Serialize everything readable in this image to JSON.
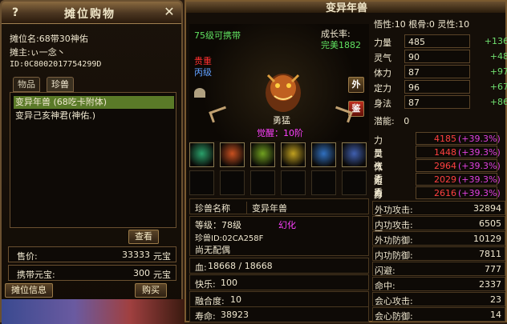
{
  "stall": {
    "title": "摊位购物",
    "help_label": "?",
    "close_label": "✕",
    "stall_name_line": "摊位名:68带30神佑",
    "owner_line": "摊主:ぃ一念丶",
    "id_line": "ID:0C8002017754299D",
    "tabs": [
      {
        "label": "物品",
        "active": false
      },
      {
        "label": "珍兽",
        "active": true
      }
    ],
    "items": [
      {
        "label": "变异年兽 (68吃卡附体)",
        "selected": true
      },
      {
        "label": "变异己亥神君(神佑.)",
        "selected": false
      }
    ],
    "view_button": "查看",
    "price_label": "售价:",
    "price_value": "33333",
    "price_unit": "元宝",
    "carry_label": "携带元宝:",
    "carry_value": "300",
    "carry_unit": "元宝",
    "info_button": "摊位信息",
    "buy_button": "购买"
  },
  "pet": {
    "title": "变异年兽",
    "level_carry": "75级可携带",
    "growth_label": "成长率:",
    "growth_value": "完美1882",
    "rarity": "贵重",
    "grade": "丙级",
    "outer_button": "外",
    "appraise_button": "鉴",
    "temperament": "勇猛",
    "awakening": "觉醒：10阶",
    "skills": [
      {
        "name": "skill-1",
        "color": "#2aa06a"
      },
      {
        "name": "skill-2",
        "color": "#c85020"
      },
      {
        "name": "skill-3",
        "color": "#70a020"
      },
      {
        "name": "skill-4",
        "color": "#c0a020"
      },
      {
        "name": "skill-5",
        "color": "#3070c0"
      },
      {
        "name": "skill-6",
        "color": "#4060b0"
      }
    ],
    "name_label": "珍兽名称",
    "name_value": "变异年兽",
    "level_line": "等级：78级",
    "mutation": "幻化",
    "pet_id": "珍兽ID:02CA258F",
    "spouse": "尚无配偶",
    "hp_label": "血:",
    "hp_value": "18668 / 18668",
    "happy_label": "快乐:",
    "happy_value": "100",
    "fusion_label": "融合度:",
    "fusion_value": "10",
    "life_label": "寿命:",
    "life_value": "38923"
  },
  "attributes": {
    "top_line": "悟性:10  根骨:0  灵性:10",
    "stats": [
      {
        "label": "力量",
        "value": "485",
        "bonus": "+136"
      },
      {
        "label": "灵气",
        "value": "90",
        "bonus": "+48"
      },
      {
        "label": "体力",
        "value": "87",
        "bonus": "+97"
      },
      {
        "label": "定力",
        "value": "96",
        "bonus": "+67"
      },
      {
        "label": "身法",
        "value": "87",
        "bonus": "+86"
      }
    ],
    "potential_label": "潜能:",
    "potential_value": "0",
    "aptitudes": [
      {
        "label": "力量资质",
        "value": "4185",
        "pct": "(+39.3%)"
      },
      {
        "label": "灵气资质",
        "value": "1448",
        "pct": "(+39.3%)"
      },
      {
        "label": "体力资质",
        "value": "2964",
        "pct": "(+39.3%)"
      },
      {
        "label": "定力资质",
        "value": "2029",
        "pct": "(+39.3%)"
      },
      {
        "label": "身法资质",
        "value": "2616",
        "pct": "(+39.3%)"
      }
    ],
    "combat": [
      {
        "label": "外功攻击:",
        "value": "32894"
      },
      {
        "label": "内功攻击:",
        "value": "6505"
      },
      {
        "label": "外功防御:",
        "value": "10129"
      },
      {
        "label": "内功防御:",
        "value": "7811"
      },
      {
        "label": "闪避:",
        "value": "777"
      },
      {
        "label": "命中:",
        "value": "2337"
      },
      {
        "label": "会心攻击:",
        "value": "23"
      },
      {
        "label": "会心防御:",
        "value": "14"
      }
    ]
  }
}
